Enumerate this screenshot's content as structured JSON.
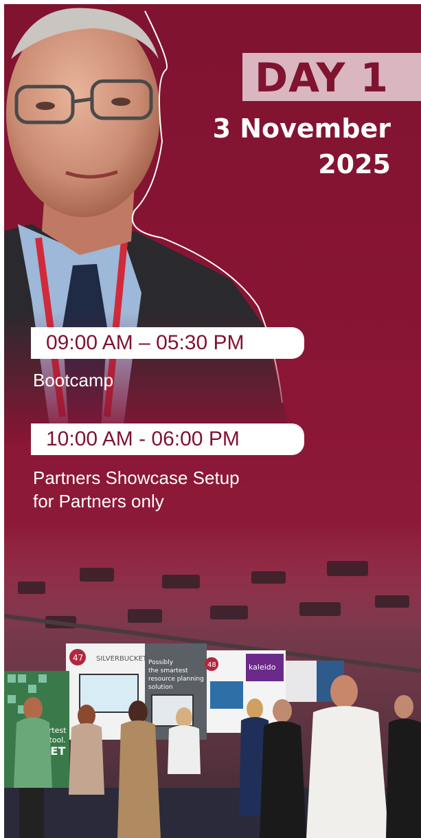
{
  "day_badge": "DAY 1",
  "date": {
    "line1": "3 November",
    "line2": "2025"
  },
  "sessions": [
    {
      "time": "09:00 AM – 05:30 PM",
      "title": "Bootcamp"
    },
    {
      "time": "10:00 AM - 06:00 PM",
      "title_line1": "Partners Showcase Setup",
      "title_line2": "for Partners only"
    }
  ],
  "booths": {
    "booth_47_number": "47",
    "booth_47_brand": "SILVERBUCKET",
    "booth_47_tagline": [
      "Possibly",
      "the smartest",
      "resource planning",
      "solution"
    ],
    "booth_48_number": "48",
    "booth_48_brand": "kaleido",
    "left_banner_partial": [
      "artest",
      "g tool.",
      "KET"
    ]
  },
  "colors": {
    "brand": "#7f1330",
    "badge": "#d9b6c0",
    "text_light": "#ffffff"
  }
}
